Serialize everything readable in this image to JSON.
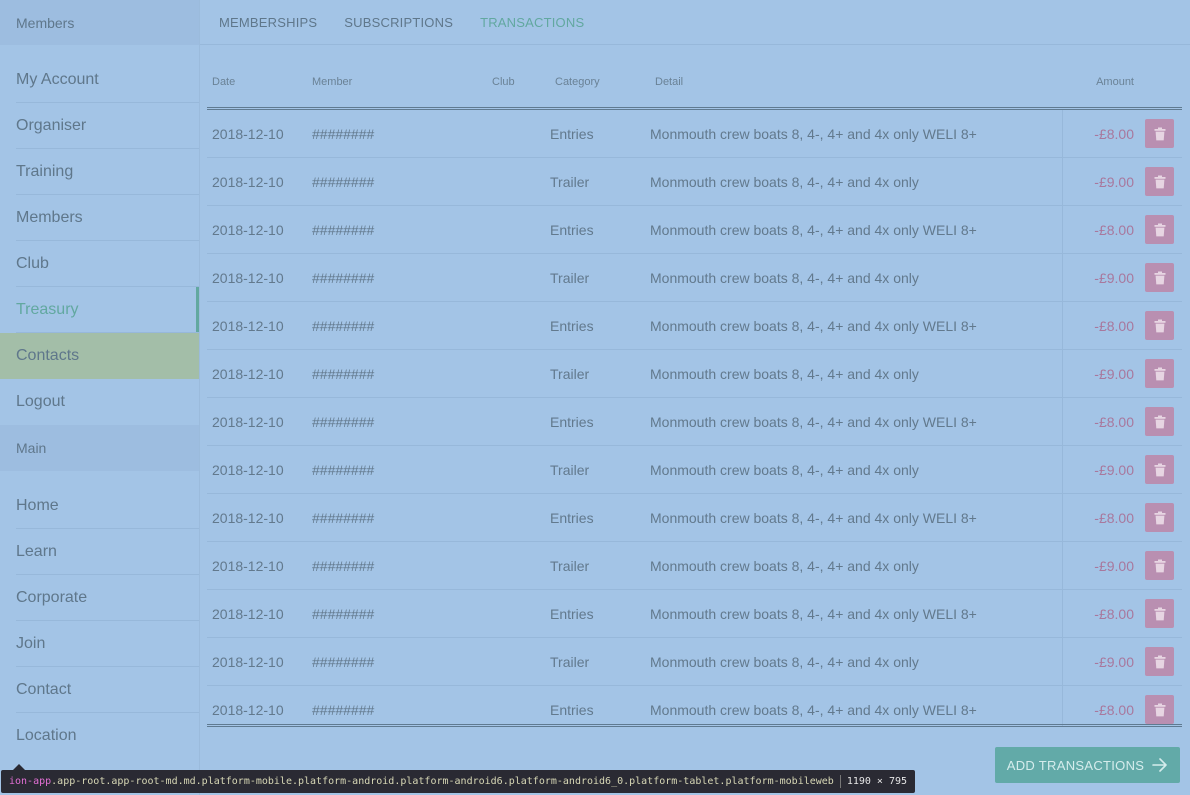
{
  "sidebar": {
    "header": "Members",
    "members_items": [
      {
        "label": "My Account"
      },
      {
        "label": "Organiser"
      },
      {
        "label": "Training"
      },
      {
        "label": "Members"
      },
      {
        "label": "Club"
      },
      {
        "label": "Treasury"
      },
      {
        "label": "Contacts"
      },
      {
        "label": "Logout"
      }
    ],
    "group_header": "Main",
    "main_items": [
      {
        "label": "Home"
      },
      {
        "label": "Learn"
      },
      {
        "label": "Corporate"
      },
      {
        "label": "Join"
      },
      {
        "label": "Contact"
      },
      {
        "label": "Location"
      }
    ],
    "active_item": "Treasury",
    "highlighted_item": "Contacts"
  },
  "tabs": [
    {
      "label": "MEMBERSHIPS"
    },
    {
      "label": "SUBSCRIPTIONS"
    },
    {
      "label": "TRANSACTIONS"
    }
  ],
  "active_tab": "TRANSACTIONS",
  "table": {
    "headers": {
      "date": "Date",
      "member": "Member",
      "club": "Club",
      "category": "Category",
      "detail": "Detail",
      "amount": "Amount"
    },
    "rows": [
      {
        "date": "2018-12-10",
        "member": "########",
        "club": "",
        "category": "Entries",
        "detail": "Monmouth crew boats 8, 4-, 4+ and 4x only WELI 8+",
        "amount": "-£8.00"
      },
      {
        "date": "2018-12-10",
        "member": "########",
        "club": "",
        "category": "Trailer",
        "detail": "Monmouth crew boats 8, 4-, 4+ and 4x only",
        "amount": "-£9.00"
      },
      {
        "date": "2018-12-10",
        "member": "########",
        "club": "",
        "category": "Entries",
        "detail": "Monmouth crew boats 8, 4-, 4+ and 4x only WELI 8+",
        "amount": "-£8.00"
      },
      {
        "date": "2018-12-10",
        "member": "########",
        "club": "",
        "category": "Trailer",
        "detail": "Monmouth crew boats 8, 4-, 4+ and 4x only",
        "amount": "-£9.00"
      },
      {
        "date": "2018-12-10",
        "member": "########",
        "club": "",
        "category": "Entries",
        "detail": "Monmouth crew boats 8, 4-, 4+ and 4x only WELI 8+",
        "amount": "-£8.00"
      },
      {
        "date": "2018-12-10",
        "member": "########",
        "club": "",
        "category": "Trailer",
        "detail": "Monmouth crew boats 8, 4-, 4+ and 4x only",
        "amount": "-£9.00"
      },
      {
        "date": "2018-12-10",
        "member": "########",
        "club": "",
        "category": "Entries",
        "detail": "Monmouth crew boats 8, 4-, 4+ and 4x only WELI 8+",
        "amount": "-£8.00"
      },
      {
        "date": "2018-12-10",
        "member": "########",
        "club": "",
        "category": "Trailer",
        "detail": "Monmouth crew boats 8, 4-, 4+ and 4x only",
        "amount": "-£9.00"
      },
      {
        "date": "2018-12-10",
        "member": "########",
        "club": "",
        "category": "Entries",
        "detail": "Monmouth crew boats 8, 4-, 4+ and 4x only WELI 8+",
        "amount": "-£8.00"
      },
      {
        "date": "2018-12-10",
        "member": "########",
        "club": "",
        "category": "Trailer",
        "detail": "Monmouth crew boats 8, 4-, 4+ and 4x only",
        "amount": "-£9.00"
      },
      {
        "date": "2018-12-10",
        "member": "########",
        "club": "",
        "category": "Entries",
        "detail": "Monmouth crew boats 8, 4-, 4+ and 4x only WELI 8+",
        "amount": "-£8.00"
      },
      {
        "date": "2018-12-10",
        "member": "########",
        "club": "",
        "category": "Trailer",
        "detail": "Monmouth crew boats 8, 4-, 4+ and 4x only",
        "amount": "-£9.00"
      },
      {
        "date": "2018-12-10",
        "member": "########",
        "club": "",
        "category": "Entries",
        "detail": "Monmouth crew boats 8, 4-, 4+ and 4x only WELI 8+",
        "amount": "-£8.00"
      }
    ],
    "row_action_icon": "trash-icon"
  },
  "add_button": {
    "label": "ADD TRANSACTIONS",
    "icon": "arrow-right-icon"
  },
  "devtools_tooltip": {
    "tag": "ion-app",
    "classes": ".app-root.app-root-md.md.platform-mobile.platform-android.platform-android6.platform-android6_0.platform-tablet.platform-mobileweb",
    "size": "1190 × 795"
  },
  "colors": {
    "background": "#a3c4e6",
    "accent": "#62a8a0",
    "amount": "#a8789d",
    "delete_button": "#b98fb1",
    "highlight": "#a3bea8"
  }
}
